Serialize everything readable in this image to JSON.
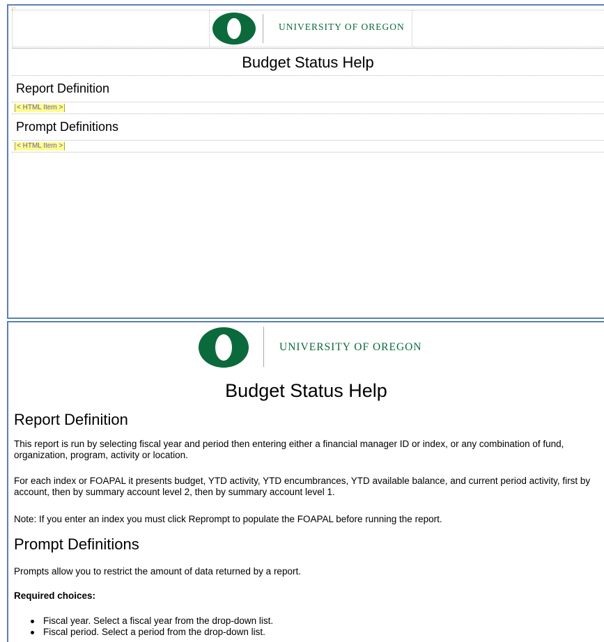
{
  "brand": {
    "name": "UNIVERSITY OF OREGON",
    "green": "#0b6a3c"
  },
  "design_view": {
    "title": "Budget Status Help",
    "section1": "Report Definition",
    "section2": "Prompt Definitions",
    "html_item_label": "< HTML Item >"
  },
  "report": {
    "title": "Budget Status Help",
    "section1_heading": "Report Definition",
    "p1": "This report is run by selecting fiscal year and period then entering either a financial manager ID or index, or any combination of fund, organization, program, activity or location.",
    "p2": "For each index or FOAPAL it presents budget, YTD activity, YTD encumbrances, YTD available balance, and current period activity, first by account, then by summary account level 2, then by summary account level 1.",
    "p3": "Note: If you enter an index you must click Reprompt to populate the FOAPAL before running the report.",
    "section2_heading": "Prompt Definitions",
    "p4": "Prompts allow you to restrict the amount of data returned by a report.",
    "required_label": "Required choices:",
    "required_items": [
      "Fiscal year. Select a fiscal year from the drop-down list.",
      "Fiscal period. Select a period from the drop-down list."
    ]
  }
}
